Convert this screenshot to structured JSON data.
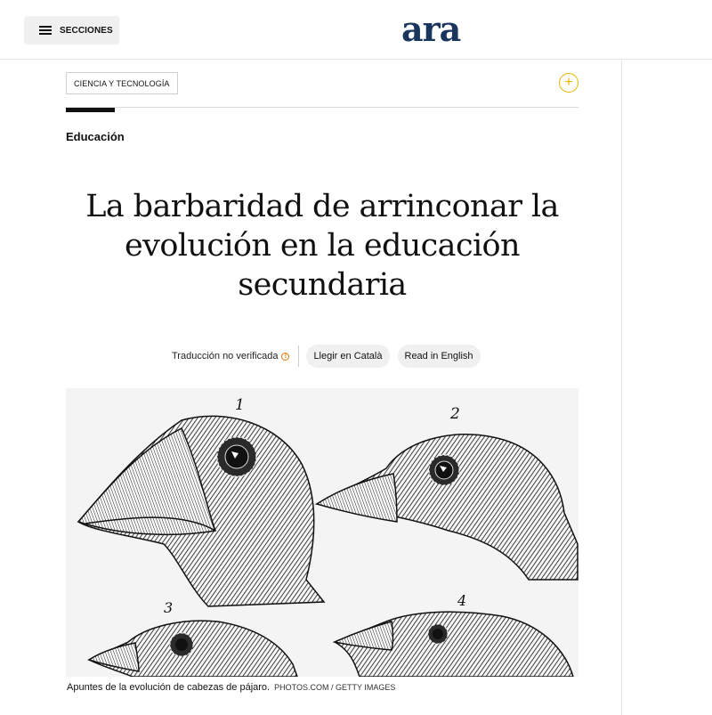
{
  "header": {
    "menu_label": "SECCIONES",
    "logo": "ara"
  },
  "section": {
    "tag": "CIENCIA Y TECNOLOGÍA",
    "kicker": "Educación"
  },
  "article": {
    "headline": "La barbaridad de arrinconar la evolución en la educación secundaria"
  },
  "translation": {
    "note": "Traducción no verificada",
    "buttons": [
      "Llegir en Català",
      "Read in English"
    ]
  },
  "figure": {
    "numbers": [
      "1",
      "2",
      "3",
      "4"
    ],
    "caption": "Apuntes de la evolución de cabezas de pájaro.",
    "credit": "PHOTOS.COM / GETTY IMAGES"
  },
  "colors": {
    "logo": "#1b365d",
    "follow_accent": "#e9b400",
    "info_icon": "#d97a00"
  },
  "icons": [
    "menu-icon",
    "plus-icon",
    "info-icon"
  ]
}
